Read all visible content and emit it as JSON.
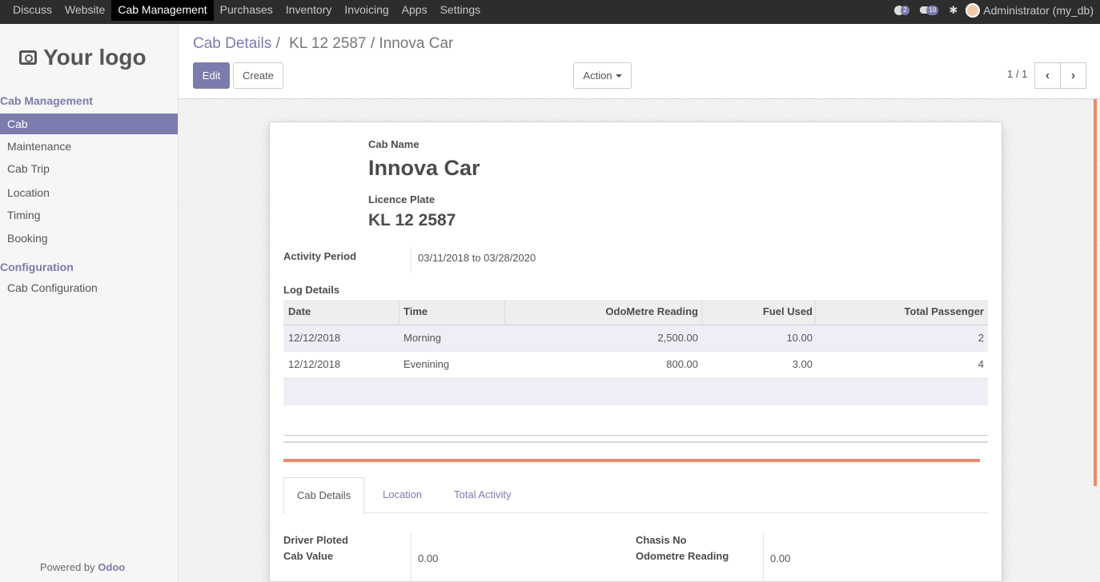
{
  "topbar": {
    "menu": [
      "Discuss",
      "Website",
      "Cab Management",
      "Purchases",
      "Inventory",
      "Invoicing",
      "Apps",
      "Settings"
    ],
    "active_index": 2,
    "chat_count": "2",
    "message_count": "10",
    "user": "Administrator (my_db)"
  },
  "sidebar": {
    "logo_text": "Your logo",
    "section1": "Cab Management",
    "items": [
      "Cab",
      "Maintenance",
      "Cab Trip",
      "Location",
      "Timing",
      "Booking"
    ],
    "section2": "Configuration",
    "config_items": [
      "Cab Configuration"
    ],
    "powered_prefix": "Powered by",
    "powered_brand": "Odoo"
  },
  "control_panel": {
    "breadcrumb_parent": "Cab Details",
    "breadcrumb_sep": "/",
    "breadcrumb_current": "KL 12 2587 / Innova Car",
    "edit_label": "Edit",
    "create_label": "Create",
    "action_label": "Action",
    "pager": "1 / 1"
  },
  "form": {
    "cab_name_label": "Cab Name",
    "cab_name": "Innova Car",
    "licence_plate_label": "Licence Plate",
    "licence_plate": "KL 12 2587",
    "activity_period_label": "Activity Period",
    "activity_period": "03/11/2018 to 03/28/2020",
    "log_details_label": "Log Details"
  },
  "log_table": {
    "columns": [
      "Date",
      "Time",
      "OdoMetre Reading",
      "Fuel Used",
      "Total Passenger"
    ],
    "rows": [
      [
        "12/12/2018",
        "Morning",
        "2,500.00",
        "10.00",
        "2"
      ],
      [
        "12/12/2018",
        "Evenining",
        "800.00",
        "3.00",
        "4"
      ]
    ]
  },
  "tabs": [
    "Cab Details",
    "Location",
    "Total Activity"
  ],
  "tab_content": {
    "driver_ploted_label": "Driver Ploted",
    "cab_value_label": "Cab Value",
    "cab_value": "0.00",
    "chasis_no_label": "Chasis No",
    "odometre_reading_label": "Odometre Reading",
    "odometre_reading": "0.00"
  },
  "colors": {
    "brand": "#7c7bad",
    "accent": "#e88c68",
    "topbar": "#2d2d2d"
  }
}
